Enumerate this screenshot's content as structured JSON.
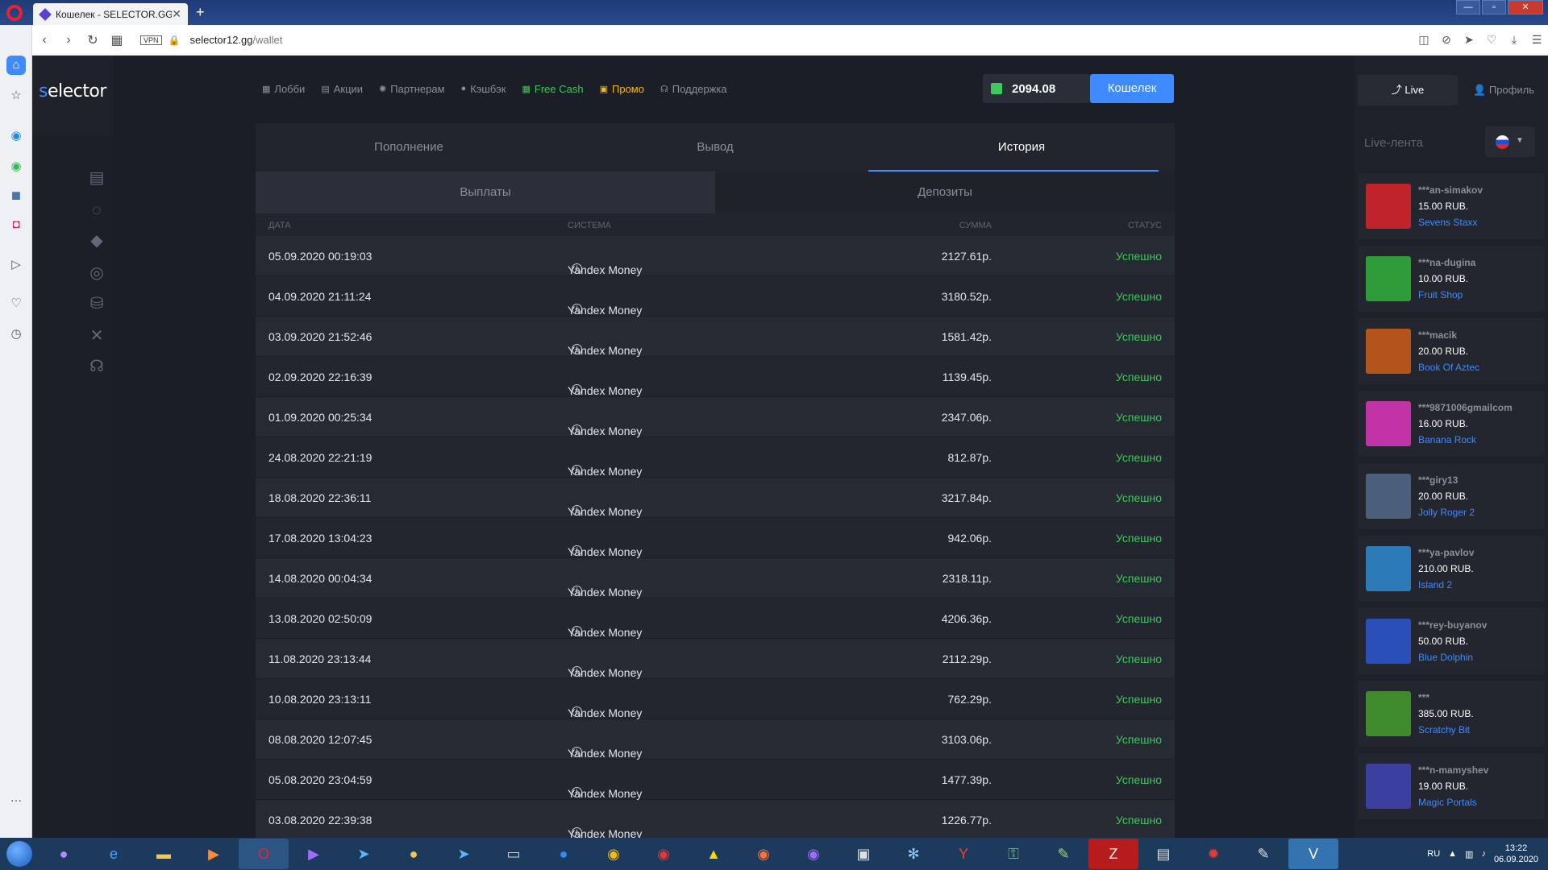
{
  "browser": {
    "tab_title": "Кошелек - SELECTOR.GG",
    "tab_close": "✕",
    "new_tab": "+",
    "url_host": "selector12.gg",
    "url_path": "/wallet",
    "vpn_badge": "VPN"
  },
  "site": {
    "logo_s": "s",
    "logo_rest": "elector",
    "nav": [
      {
        "label": "Лобби",
        "icon": "lobby-icon"
      },
      {
        "label": "Акции",
        "icon": "promo-calendar-icon"
      },
      {
        "label": "Партнерам",
        "icon": "partners-icon"
      },
      {
        "label": "Кэшбэк",
        "icon": "cashback-icon"
      },
      {
        "label": "Free Cash",
        "icon": "free-cash-icon",
        "color": "#3fc85b"
      },
      {
        "label": "Промо",
        "icon": "gift-icon",
        "color": "#f2b91c"
      },
      {
        "label": "Поддержка",
        "icon": "support-headset-icon"
      }
    ],
    "balance": "2094.08",
    "wallet_button": "Кошелек"
  },
  "wallet": {
    "tabs": [
      "Пополнение",
      "Вывод",
      "История"
    ],
    "active_tab": "История",
    "subtabs": [
      "Выплаты",
      "Депозиты"
    ],
    "headers": {
      "date": "Дата",
      "system": "Система",
      "sum": "Сумма",
      "status": "Статус"
    },
    "rows": [
      {
        "date": "05.09.2020 00:19:03",
        "system": "Yandex Money",
        "sum": "2127.61р.",
        "status": "Успешно"
      },
      {
        "date": "04.09.2020 21:11:24",
        "system": "Yandex Money",
        "sum": "3180.52р.",
        "status": "Успешно"
      },
      {
        "date": "03.09.2020 21:52:46",
        "system": "Yandex Money",
        "sum": "1581.42р.",
        "status": "Успешно"
      },
      {
        "date": "02.09.2020 22:16:39",
        "system": "Yandex Money",
        "sum": "1139.45р.",
        "status": "Успешно"
      },
      {
        "date": "01.09.2020 00:25:34",
        "system": "Yandex Money",
        "sum": "2347.06р.",
        "status": "Успешно"
      },
      {
        "date": "24.08.2020 22:21:19",
        "system": "Yandex Money",
        "sum": "812.87р.",
        "status": "Успешно"
      },
      {
        "date": "18.08.2020 22:36:11",
        "system": "Yandex Money",
        "sum": "3217.84р.",
        "status": "Успешно"
      },
      {
        "date": "17.08.2020 13:04:23",
        "system": "Yandex Money",
        "sum": "942.06р.",
        "status": "Успешно"
      },
      {
        "date": "14.08.2020 00:04:34",
        "system": "Yandex Money",
        "sum": "2318.11р.",
        "status": "Успешно"
      },
      {
        "date": "13.08.2020 02:50:09",
        "system": "Yandex Money",
        "sum": "4206.36р.",
        "status": "Успешно"
      },
      {
        "date": "11.08.2020 23:13:44",
        "system": "Yandex Money",
        "sum": "2112.29р.",
        "status": "Успешно"
      },
      {
        "date": "10.08.2020 23:13:11",
        "system": "Yandex Money",
        "sum": "762.29р.",
        "status": "Успешно"
      },
      {
        "date": "08.08.2020 12:07:45",
        "system": "Yandex Money",
        "sum": "3103.06р.",
        "status": "Успешно"
      },
      {
        "date": "05.08.2020 23:04:59",
        "system": "Yandex Money",
        "sum": "1477.39р.",
        "status": "Успешно"
      },
      {
        "date": "03.08.2020 22:39:38",
        "system": "Yandex Money",
        "sum": "1226.77р.",
        "status": "Успешно"
      }
    ]
  },
  "live": {
    "live_button": "Live",
    "profile_button": "Профиль",
    "feed_title": "Live-лента",
    "items": [
      {
        "user": "***an-simakov",
        "amount": "15.00 RUB.",
        "game": "Sevens Staxx",
        "thumb_color": "#c0242a"
      },
      {
        "user": "***na-dugina",
        "amount": "10.00 RUB.",
        "game": "Fruit Shop",
        "thumb_color": "#2f9c3a"
      },
      {
        "user": "***macik",
        "amount": "20.00 RUB.",
        "game": "Book Of Aztec",
        "thumb_color": "#b3541c"
      },
      {
        "user": "***9871006gmailcom",
        "amount": "16.00 RUB.",
        "game": "Banana Rock",
        "thumb_color": "#c233a8"
      },
      {
        "user": "***giry13",
        "amount": "20.00 RUB.",
        "game": "Jolly Roger 2",
        "thumb_color": "#4b5f7a"
      },
      {
        "user": "***ya-pavlov",
        "amount": "210.00 RUB.",
        "game": "Island 2",
        "thumb_color": "#2c7ab8"
      },
      {
        "user": "***rey-buyanov",
        "amount": "50.00 RUB.",
        "game": "Blue Dolphin",
        "thumb_color": "#2a4fb8"
      },
      {
        "user": "***",
        "amount": "385.00 RUB.",
        "game": "Scratchy Bit",
        "thumb_color": "#3e8a2d"
      },
      {
        "user": "***n-mamyshev",
        "amount": "19.00 RUB.",
        "game": "Magic Portals",
        "thumb_color": "#3a3fa0"
      }
    ]
  },
  "taskbar": {
    "lang": "RU",
    "time": "13:22",
    "date": "06.09.2020"
  },
  "colors": {
    "accent": "#3d8bff",
    "success": "#3fc85b",
    "promo": "#f2b91c"
  }
}
